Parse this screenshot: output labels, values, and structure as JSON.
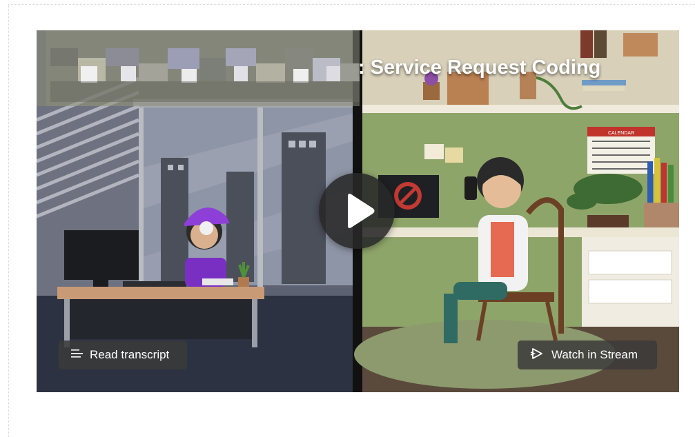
{
  "video": {
    "title": ": Service Request Coding",
    "title_redacted": true
  },
  "controls": {
    "play_icon": "play-icon",
    "read_transcript_label": "Read transcript",
    "read_transcript_icon": "transcript-lines-icon",
    "watch_in_stream_label": "Watch in Stream",
    "watch_in_stream_icon": "stream-play-icon"
  },
  "calendar": {
    "header": "CALENDAR"
  },
  "colors": {
    "button_bg": "#3a3a3a",
    "play_bg": "#282828",
    "title_text": "#ffffff"
  }
}
